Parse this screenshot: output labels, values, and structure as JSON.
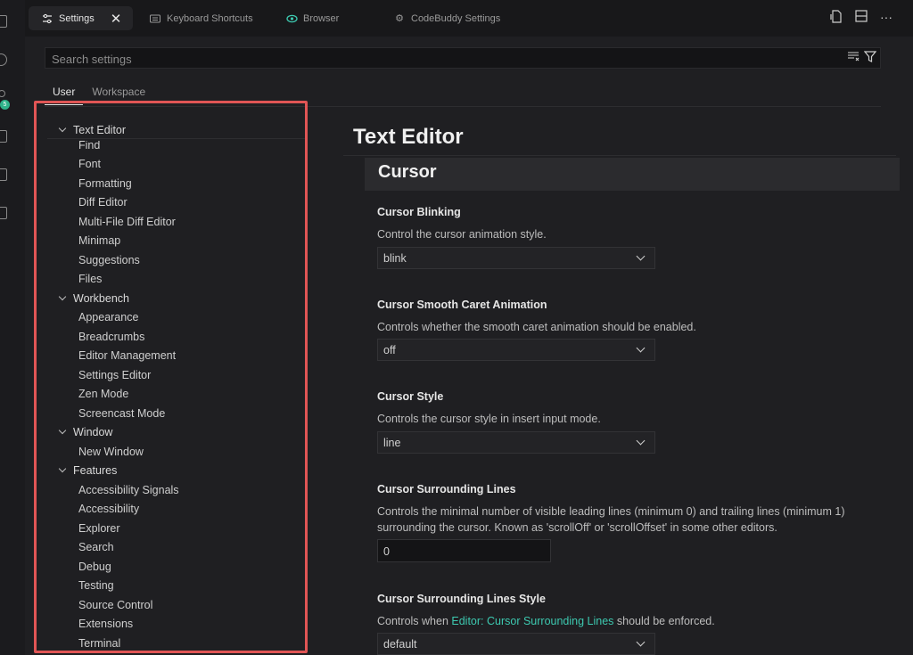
{
  "tabs": [
    {
      "label": "Settings",
      "icon": "settings-sliders-icon"
    },
    {
      "label": "Keyboard Shortcuts",
      "icon": "keyboard-icon"
    },
    {
      "label": "Browser",
      "icon": "eye-icon"
    },
    {
      "label": "CodeBuddy Settings",
      "icon": "gear-icon"
    }
  ],
  "search": {
    "placeholder": "Search settings"
  },
  "scope": {
    "user": "User",
    "workspace": "Workspace"
  },
  "activity_badge": "5",
  "toc": [
    {
      "label": "Text Editor",
      "type": "category"
    },
    {
      "label": "Find"
    },
    {
      "label": "Font"
    },
    {
      "label": "Formatting"
    },
    {
      "label": "Diff Editor"
    },
    {
      "label": "Multi-File Diff Editor"
    },
    {
      "label": "Minimap"
    },
    {
      "label": "Suggestions"
    },
    {
      "label": "Files"
    },
    {
      "label": "Workbench",
      "type": "category"
    },
    {
      "label": "Appearance"
    },
    {
      "label": "Breadcrumbs"
    },
    {
      "label": "Editor Management"
    },
    {
      "label": "Settings Editor"
    },
    {
      "label": "Zen Mode"
    },
    {
      "label": "Screencast Mode"
    },
    {
      "label": "Window",
      "type": "category"
    },
    {
      "label": "New Window"
    },
    {
      "label": "Features",
      "type": "category"
    },
    {
      "label": "Accessibility Signals"
    },
    {
      "label": "Accessibility"
    },
    {
      "label": "Explorer"
    },
    {
      "label": "Search"
    },
    {
      "label": "Debug"
    },
    {
      "label": "Testing"
    },
    {
      "label": "Source Control"
    },
    {
      "label": "Extensions"
    },
    {
      "label": "Terminal"
    }
  ],
  "content": {
    "title": "Text Editor",
    "section": "Cursor",
    "settings": [
      {
        "title": "Cursor Blinking",
        "description": "Control the cursor animation style.",
        "control": "select",
        "value": "blink"
      },
      {
        "title": "Cursor Smooth Caret Animation",
        "description": "Controls whether the smooth caret animation should be enabled.",
        "control": "select",
        "value": "off"
      },
      {
        "title": "Cursor Style",
        "description": "Controls the cursor style in insert input mode.",
        "control": "select",
        "value": "line"
      },
      {
        "title": "Cursor Surrounding Lines",
        "description": "Controls the minimal number of visible leading lines (minimum 0) and trailing lines (minimum 1) surrounding the cursor. Known as 'scrollOff' or 'scrollOffset' in some other editors.",
        "control": "number",
        "value": "0"
      },
      {
        "title": "Cursor Surrounding Lines Style",
        "description_pre": "Controls when ",
        "description_link": "Editor: Cursor Surrounding Lines",
        "description_post": " should be enforced.",
        "control": "select",
        "value": "default"
      }
    ]
  },
  "colors": {
    "highlight_border": "#e05555",
    "link": "#3dc9b0",
    "background": "#1f1f22"
  }
}
